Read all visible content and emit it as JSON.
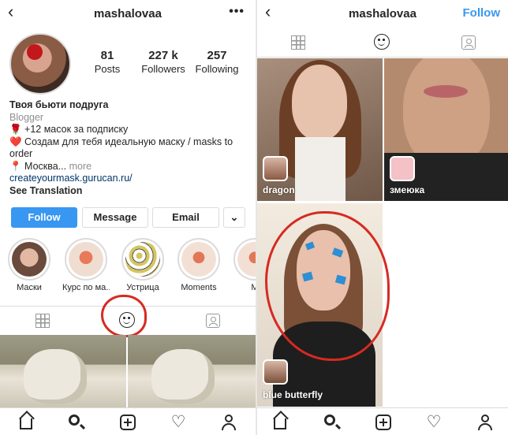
{
  "left": {
    "username": "mashalovaa",
    "stats": [
      {
        "value": "81",
        "label": "Posts"
      },
      {
        "value": "227 k",
        "label": "Followers"
      },
      {
        "value": "257",
        "label": "Following"
      }
    ],
    "bio": {
      "name": "Твоя бьюти подруга",
      "category": "Blogger",
      "line1": "🌹 +12 масок за подписку",
      "line2": "❤️ Создам для тебя идеальную маску / masks to order",
      "location": "📍 Москва...",
      "more": " more",
      "link": "createyourmask.gurucan.ru/",
      "translate": "See Translation"
    },
    "buttons": {
      "follow": "Follow",
      "message": "Message",
      "email": "Email",
      "dropdown": "⌄"
    },
    "highlights": [
      "Маски",
      "Курс по ма...",
      "Устрица",
      "Moments",
      "M"
    ]
  },
  "right": {
    "username": "mashalovaa",
    "follow": "Follow",
    "effects": [
      "dragon",
      "змеюка",
      "blue butterfly"
    ]
  },
  "colors": {
    "accent": "#3897f0",
    "annotation": "#d62a22"
  },
  "icons": {
    "back": "‹",
    "more": "•••",
    "heart": "♡"
  }
}
